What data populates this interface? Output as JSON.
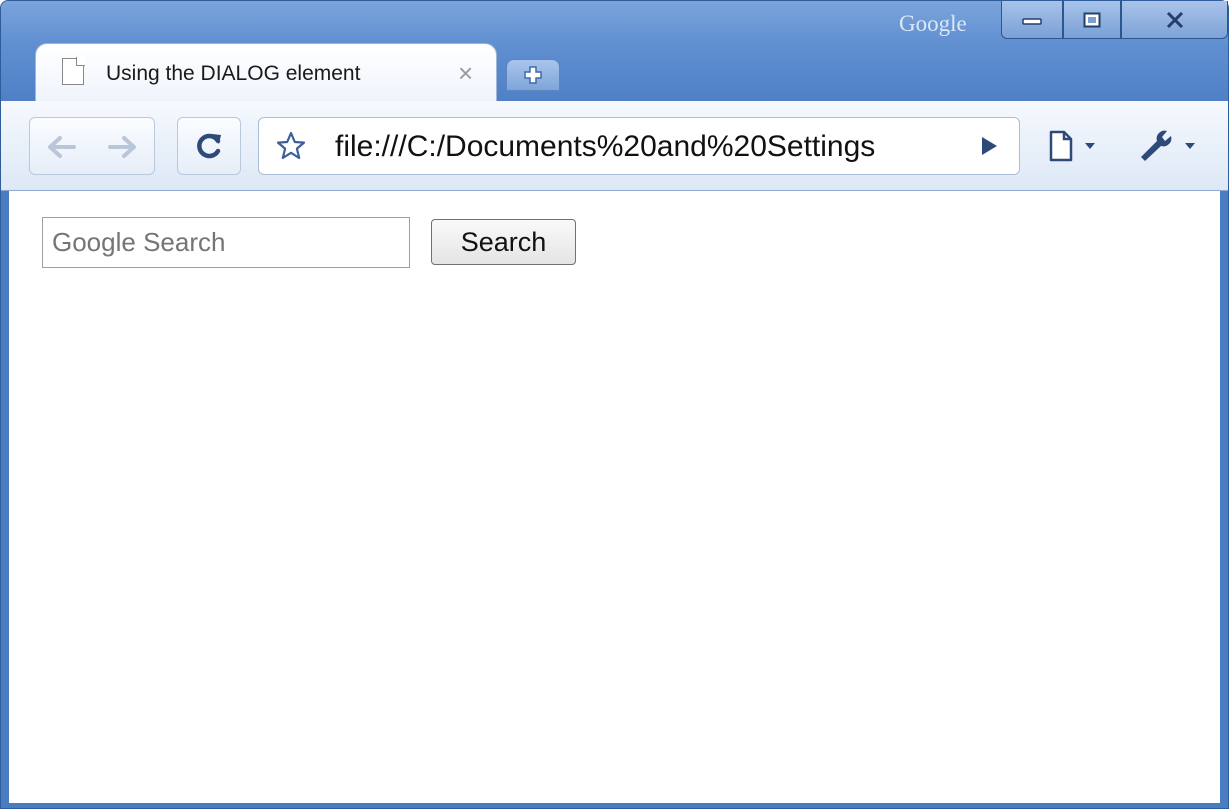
{
  "window": {
    "brand": "Google",
    "controls": {
      "minimize_icon": "minimize-icon",
      "maximize_icon": "maximize-icon",
      "close_icon": "close-icon"
    }
  },
  "tabs": [
    {
      "title": "Using the DIALOG element",
      "close_icon": "close-icon",
      "page_icon": "document-icon"
    }
  ],
  "new_tab_icon": "plus-icon",
  "toolbar": {
    "back_icon": "back-arrow-icon",
    "forward_icon": "forward-arrow-icon",
    "reload_icon": "reload-icon",
    "bookmark_icon": "star-icon",
    "address": "file:///C:/Documents%20and%20Settings",
    "go_icon": "play-icon",
    "page_menu_icon": "page-menu-icon",
    "tools_menu_icon": "wrench-icon"
  },
  "page": {
    "search": {
      "placeholder": "Google Search",
      "value": ""
    },
    "search_button": "Search"
  },
  "colors": {
    "frame": "#4a7cc2",
    "toolbar": "#dde8f6",
    "tab": "#ffffff",
    "placeholder_text": "#b0b0b0"
  }
}
